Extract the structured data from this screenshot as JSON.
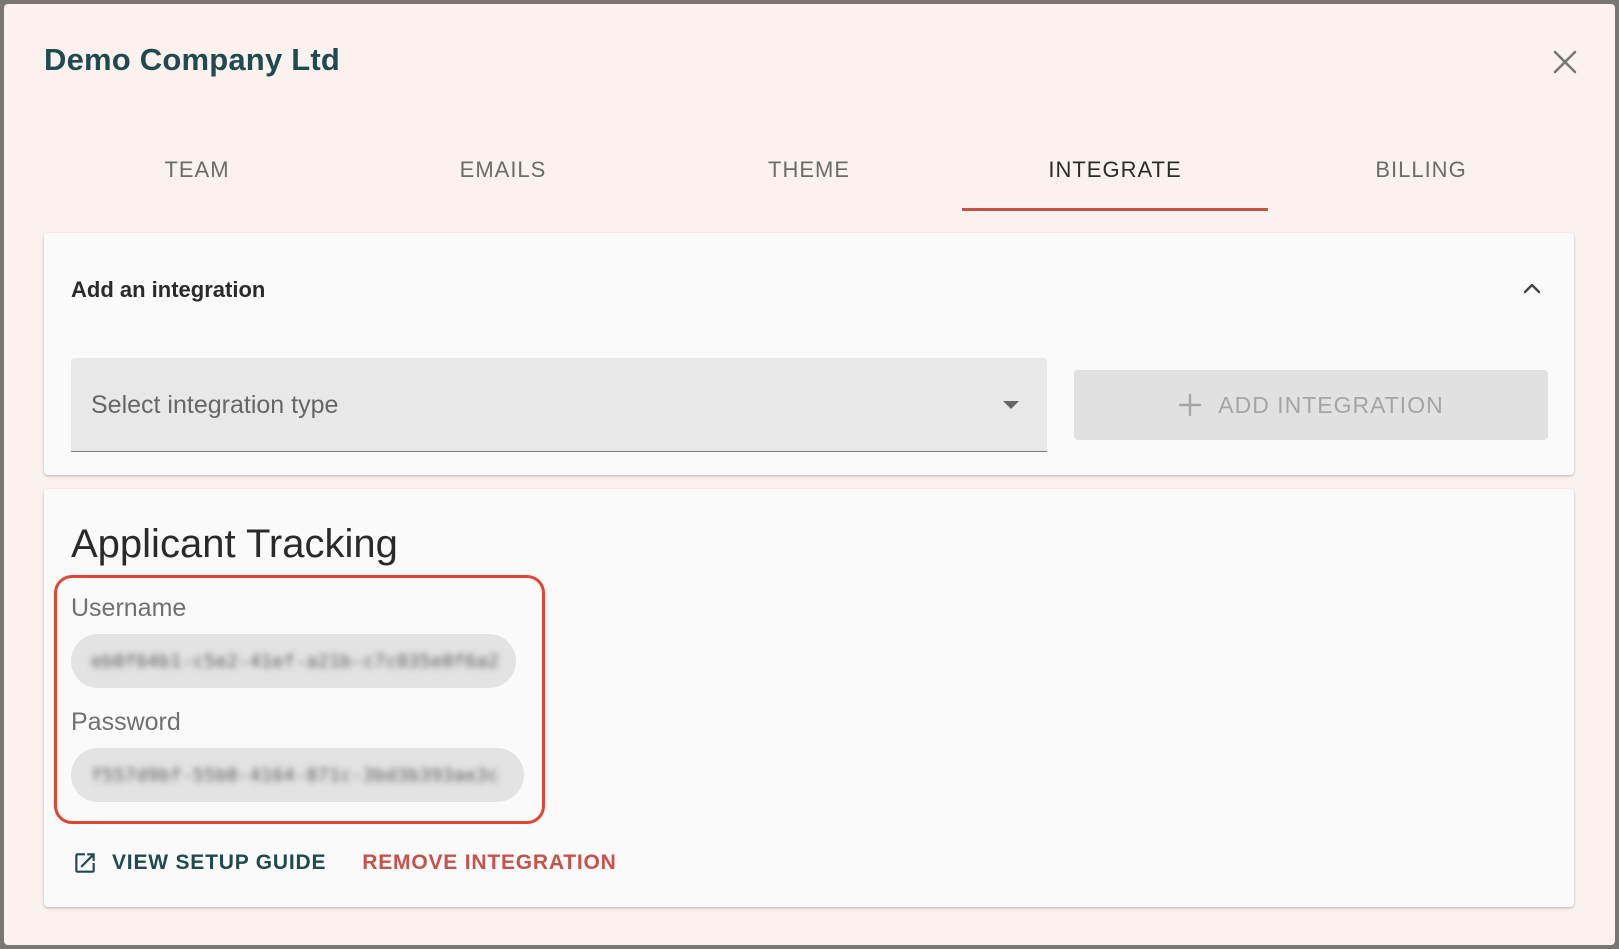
{
  "dialog": {
    "title": "Demo Company Ltd",
    "close_icon": "close-icon"
  },
  "tabs": [
    {
      "label": "TEAM",
      "active": false
    },
    {
      "label": "EMAILS",
      "active": false
    },
    {
      "label": "THEME",
      "active": false
    },
    {
      "label": "INTEGRATE",
      "active": true
    },
    {
      "label": "BILLING",
      "active": false
    }
  ],
  "add_integration": {
    "header": "Add an integration",
    "collapse_icon": "chevron-up-icon",
    "select_placeholder": "Select integration type",
    "button_label": "ADD INTEGRATION",
    "button_icon": "plus-icon"
  },
  "integration": {
    "title": "Applicant Tracking",
    "username_label": "Username",
    "username_value": "eb0f64b1-c5e2-41ef-a21b-c7c035e0f6a2",
    "password_label": "Password",
    "password_value": "f557d9bf-55b0-4164-871c-3bd3b393ae3c",
    "setup_guide_label": "VIEW SETUP GUIDE",
    "setup_guide_icon": "external-link-icon",
    "remove_label": "REMOVE INTEGRATION"
  },
  "colors": {
    "accent": "#c5534c",
    "brand": "#1f4a50",
    "highlight": "#e24531",
    "dialog_bg": "#fbf1ef"
  }
}
